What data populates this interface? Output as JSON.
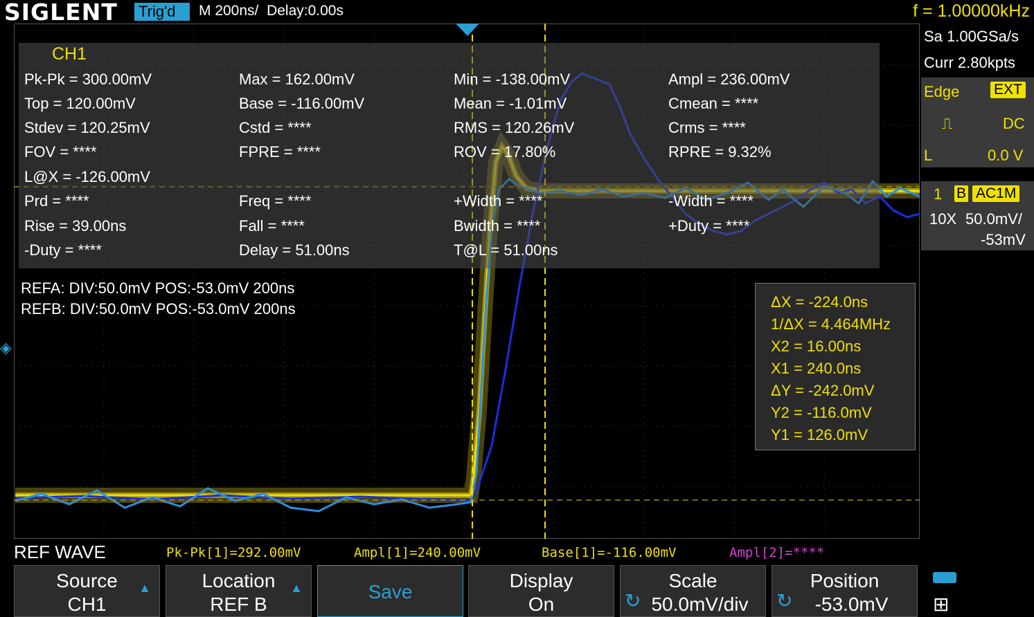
{
  "header": {
    "logo": "SIGLENT",
    "trig_status": "Trig'd",
    "timebase": "M 200ns/",
    "delay": "Delay:0.00s",
    "frequency": "f = 1.00000kHz"
  },
  "measurements": {
    "channel": "CH1",
    "rows": [
      [
        "Pk-Pk = 300.00mV",
        "Max = 162.00mV",
        "Min = -138.00mV",
        "Ampl = 236.00mV"
      ],
      [
        "Top = 120.00mV",
        "Base = -116.00mV",
        "Mean = -1.01mV",
        "Cmean = ****"
      ],
      [
        "Stdev = 120.25mV",
        "Cstd = ****",
        "RMS = 120.26mV",
        "Crms = ****"
      ],
      [
        "FOV = ****",
        "FPRE = ****",
        "ROV = 17.80%",
        "RPRE = 9.32%"
      ],
      [
        "L@X = -126.00mV",
        "",
        "",
        ""
      ],
      [
        "Prd = ****",
        "Freq = ****",
        "+Width = ****",
        "-Width = ****"
      ],
      [
        "Rise = 39.00ns",
        "Fall = ****",
        "Bwidth = ****",
        "+Duty = ****"
      ],
      [
        "-Duty = ****",
        "Delay = 51.00ns",
        "T@L = 51.00ns",
        ""
      ]
    ]
  },
  "refs": {
    "refa": "REFA: DIV:50.0mV POS:-53.0mV  200ns",
    "refb": "REFB: DIV:50.0mV POS:-53.0mV  200ns"
  },
  "cursors": {
    "dx": "ΔX = -224.0ns",
    "inv_dx": "1/ΔX = 4.464MHz",
    "x2": "X2 = 16.00ns",
    "x1": "X1 = 240.0ns",
    "dy": "ΔY = -242.0mV",
    "y2": "Y2 = -116.0mV",
    "y1": "Y1 = 126.0mV"
  },
  "side": {
    "sample_rate": "Sa 1.00GSa/s",
    "curr": "Curr 2.80kpts",
    "trig_type": "Edge",
    "trig_source": "EXT",
    "coupling": "DC",
    "level_label": "L",
    "level_value": "0.0 V",
    "ch_num": "1",
    "ch_bw": "B",
    "ch_coupling": "AC1M",
    "probe": "10X",
    "vdiv": "50.0mV/",
    "offset": "-53mV"
  },
  "status": {
    "menu": "REF WAVE",
    "m1": "Pk-Pk[1]=292.00mV",
    "m2": "Ampl[1]=240.00mV",
    "m3": "Base[1]=-116.00mV",
    "m4": "Ampl[2]=****"
  },
  "softkeys": [
    {
      "l1": "Source",
      "l2": "CH1"
    },
    {
      "l1": "Location",
      "l2": "REF B"
    },
    {
      "l1": "Save",
      "l2": ""
    },
    {
      "l1": "Display",
      "l2": "On"
    },
    {
      "l1": "Scale",
      "l2": "50.0mV/div"
    },
    {
      "l1": "Position",
      "l2": "-53.0mV"
    }
  ],
  "colors": {
    "ch1": "#f0e000",
    "ref_a": "#1a2ee0",
    "ref_b": "#2a8fe0",
    "accent": "#2aa0d2",
    "math": "#d040d0"
  }
}
